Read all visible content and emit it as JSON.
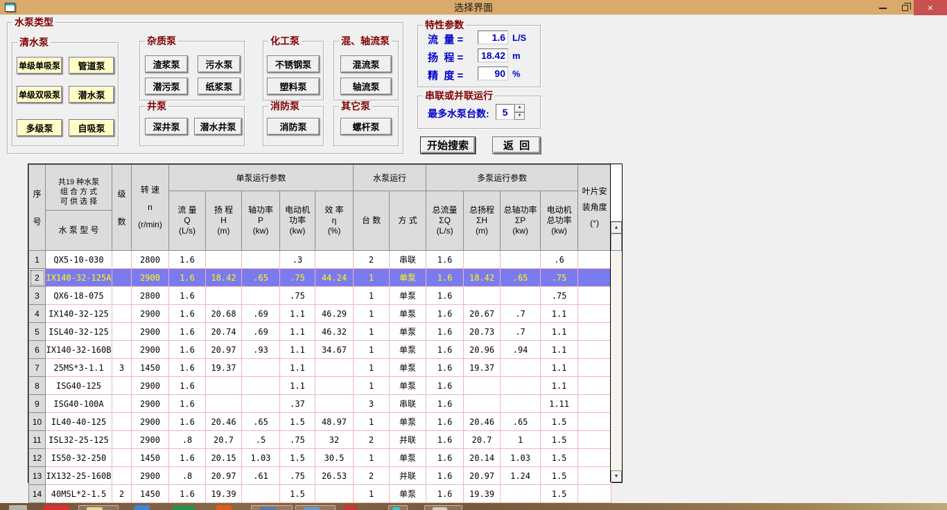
{
  "window": {
    "title": "选择界面",
    "close_glyph": "×"
  },
  "pump_types": {
    "title": "水泵类型",
    "groups": [
      {
        "label": "清水泵",
        "buttons": [
          "单级单吸泵",
          "管道泵",
          "单级双吸泵",
          "潜水泵",
          "多级泵",
          "自吸泵"
        ]
      },
      {
        "label": "杂质泵",
        "buttons": [
          "渣浆泵",
          "污水泵",
          "潜污泵",
          "纸浆泵"
        ]
      },
      {
        "label": "井泵",
        "buttons": [
          "深井泵",
          "潜水井泵"
        ]
      },
      {
        "label": "化工泵",
        "buttons": [
          "不锈钢泵",
          "塑料泵"
        ]
      },
      {
        "label": "消防泵",
        "buttons": [
          "消防泵"
        ]
      },
      {
        "label": "混、轴流泵",
        "buttons": [
          "混流泵",
          "轴流泵"
        ]
      },
      {
        "label": "其它泵",
        "buttons": [
          "螺杆泵"
        ]
      }
    ]
  },
  "parameters": {
    "title": "特性参数",
    "fields": [
      {
        "label": "流  量 =",
        "value": "1.6",
        "unit": "L/S"
      },
      {
        "label": "扬  程 =",
        "value": "18.42",
        "unit": "m"
      },
      {
        "label": "精  度 =",
        "value": "90",
        "unit": "%"
      }
    ]
  },
  "operation": {
    "title": "串联或并联运行",
    "label": "最多水泵台数:",
    "value": "5"
  },
  "actions": {
    "search": "开始搜索",
    "back": "返  回"
  },
  "table": {
    "header": {
      "no": "序\n号",
      "combos_note": "共19 种水泵\n组 合 方 式\n可 供 选 择",
      "model": "水 泵 型 号",
      "stages": "级\n数",
      "speed": "转  速\nn\n(r/min)",
      "single_group": "单泵运行参数",
      "q": "流  量\nQ\n(L/s)",
      "h": "扬  程\nH\n(m)",
      "p": "轴功率\nP\n(kw)",
      "motor": "电动机\n功率\n(kw)",
      "eff": "效  率\nη\n(%)",
      "run_group": "水泵运行",
      "units": "台  数",
      "mode": "方  式",
      "multi_group": "多泵运行参数",
      "sum_q": "总流量\nΣQ\n(L/s)",
      "sum_h": "总扬程\nΣH\n(m)",
      "sum_p": "总轴功率\nΣP\n(kw)",
      "motor_total": "电动机\n总功率\n(kw)",
      "blade": "叶片安\n装角度\n(°)"
    },
    "selected_index": 1,
    "rows": [
      [
        "QX5-10-030",
        "",
        "2800",
        "1.6",
        "",
        "",
        ".3",
        "",
        "2",
        "串联",
        "1.6",
        "",
        "",
        ".6",
        ""
      ],
      [
        "IX140-32-125A",
        "",
        "2900",
        "1.6",
        "18.42",
        ".65",
        ".75",
        "44.24",
        "1",
        "单泵",
        "1.6",
        "18.42",
        ".65",
        ".75",
        ""
      ],
      [
        "QX6-18-075",
        "",
        "2800",
        "1.6",
        "",
        "",
        ".75",
        "",
        "1",
        "单泵",
        "1.6",
        "",
        "",
        ".75",
        ""
      ],
      [
        "IX140-32-125",
        "",
        "2900",
        "1.6",
        "20.68",
        ".69",
        "1.1",
        "46.29",
        "1",
        "单泵",
        "1.6",
        "20.67",
        ".7",
        "1.1",
        ""
      ],
      [
        "ISL40-32-125",
        "",
        "2900",
        "1.6",
        "20.74",
        ".69",
        "1.1",
        "46.32",
        "1",
        "单泵",
        "1.6",
        "20.73",
        ".7",
        "1.1",
        ""
      ],
      [
        "IX140-32-160B",
        "",
        "2900",
        "1.6",
        "20.97",
        ".93",
        "1.1",
        "34.67",
        "1",
        "单泵",
        "1.6",
        "20.96",
        ".94",
        "1.1",
        ""
      ],
      [
        "25MS*3-1.1",
        "3",
        "1450",
        "1.6",
        "19.37",
        "",
        "1.1",
        "",
        "1",
        "单泵",
        "1.6",
        "19.37",
        "",
        "1.1",
        ""
      ],
      [
        "ISG40-125",
        "",
        "2900",
        "1.6",
        "",
        "",
        "1.1",
        "",
        "1",
        "单泵",
        "1.6",
        "",
        "",
        "1.1",
        ""
      ],
      [
        "ISG40-100A",
        "",
        "2900",
        "1.6",
        "",
        "",
        ".37",
        "",
        "3",
        "串联",
        "1.6",
        "",
        "",
        "1.11",
        ""
      ],
      [
        "IL40-40-125",
        "",
        "2900",
        "1.6",
        "20.46",
        ".65",
        "1.5",
        "48.97",
        "1",
        "单泵",
        "1.6",
        "20.46",
        ".65",
        "1.5",
        ""
      ],
      [
        "ISL32-25-125",
        "",
        "2900",
        ".8",
        "20.7",
        ".5",
        ".75",
        "32",
        "2",
        "并联",
        "1.6",
        "20.7",
        "1",
        "1.5",
        ""
      ],
      [
        "IS50-32-250",
        "",
        "1450",
        "1.6",
        "20.15",
        "1.03",
        "1.5",
        "30.5",
        "1",
        "单泵",
        "1.6",
        "20.14",
        "1.03",
        "1.5",
        ""
      ],
      [
        "IX132-25-160B",
        "",
        "2900",
        ".8",
        "20.97",
        ".61",
        ".75",
        "26.53",
        "2",
        "并联",
        "1.6",
        "20.97",
        "1.24",
        "1.5",
        ""
      ],
      [
        "40MSL*2-1.5",
        "2",
        "1450",
        "1.6",
        "19.39",
        "",
        "1.5",
        "",
        "1",
        "单泵",
        "1.6",
        "19.39",
        "",
        "1.5",
        ""
      ]
    ]
  },
  "colors": {
    "titlebar": "#d8aa6b",
    "close_button": "#c75050",
    "group_label": "#800000",
    "param_text": "#0000cc",
    "clean_pump_button_bg": "#ffffc4",
    "selected_row_bg": "#7b7bf0",
    "selected_row_text": "#ffff00",
    "grid_line": "#f2b6b6"
  },
  "taskbar_icons": [
    {
      "name": "app-gray",
      "color": "#b8b4ac"
    },
    {
      "name": "app-red",
      "color": "#dd3030"
    },
    {
      "name": "active-app-frame",
      "color": "#e6d89a"
    },
    {
      "name": "app-blue-circle",
      "color": "#3a85dd"
    },
    {
      "name": "app-green",
      "color": "#2f8f4f"
    },
    {
      "name": "app-orange",
      "color": "#e05a20"
    },
    {
      "name": "framed-app-blue",
      "color": "#5577bb"
    },
    {
      "name": "framed-app-blue-2",
      "color": "#6699dd"
    },
    {
      "name": "app-red-small",
      "color": "#cc3333"
    },
    {
      "name": "framed-app-cyan",
      "color": "#35c8dc"
    },
    {
      "name": "framed-app-light",
      "color": "#d8ccc0"
    }
  ]
}
